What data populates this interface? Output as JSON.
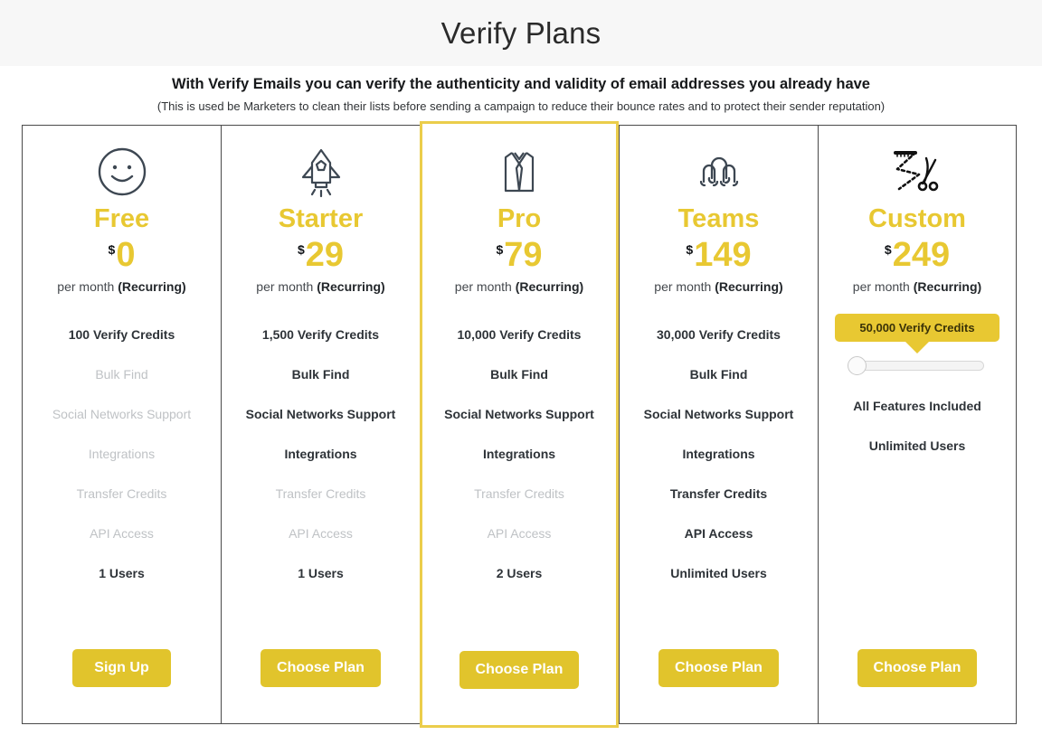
{
  "header": {
    "title": "Verify Plans",
    "subheading": "With Verify Emails you can verify the authenticity and validity of email addresses you already have",
    "subnote": "(This is used be Marketers to clean their lists before sending a campaign to reduce their bounce rates and to protect their sender reputation)"
  },
  "colors": {
    "accent_yellow": "#e8c832",
    "button_yellow": "#e1c42c",
    "featured_border": "#ebcd4b",
    "card_border": "#4a4a4a",
    "text_dark": "#2e3338",
    "text_disabled": "#bfc2c5",
    "header_band": "#f7f7f7"
  },
  "currency_symbol": "$",
  "period_label_prefix": "per month ",
  "period_label_bold": "(Recurring)",
  "plans": [
    {
      "id": "free",
      "name": "Free",
      "icon": "smiley-face-icon",
      "price": "0",
      "period_prefix": "per month ",
      "period_bold": "(Recurring)",
      "featured": false,
      "features": [
        {
          "label": "100 Verify Credits",
          "enabled": true
        },
        {
          "label": "Bulk Find",
          "enabled": false
        },
        {
          "label": "Social Networks Support",
          "enabled": false
        },
        {
          "label": "Integrations",
          "enabled": false
        },
        {
          "label": "Transfer Credits",
          "enabled": false
        },
        {
          "label": "API Access",
          "enabled": false
        },
        {
          "label": "1 Users",
          "enabled": true
        }
      ],
      "cta": "Sign Up"
    },
    {
      "id": "starter",
      "name": "Starter",
      "icon": "rocket-icon",
      "price": "29",
      "period_prefix": "per month ",
      "period_bold": "(Recurring)",
      "featured": false,
      "features": [
        {
          "label": "1,500 Verify Credits",
          "enabled": true
        },
        {
          "label": "Bulk Find",
          "enabled": true
        },
        {
          "label": "Social Networks Support",
          "enabled": true
        },
        {
          "label": "Integrations",
          "enabled": true
        },
        {
          "label": "Transfer Credits",
          "enabled": false
        },
        {
          "label": "API Access",
          "enabled": false
        },
        {
          "label": "1 Users",
          "enabled": true
        }
      ],
      "cta": "Choose Plan"
    },
    {
      "id": "pro",
      "name": "Pro",
      "icon": "shirt-tie-icon",
      "price": "79",
      "period_prefix": "per month ",
      "period_bold": "(Recurring)",
      "featured": true,
      "features": [
        {
          "label": "10,000 Verify Credits",
          "enabled": true
        },
        {
          "label": "Bulk Find",
          "enabled": true
        },
        {
          "label": "Social Networks Support",
          "enabled": true
        },
        {
          "label": "Integrations",
          "enabled": true
        },
        {
          "label": "Transfer Credits",
          "enabled": false
        },
        {
          "label": "API Access",
          "enabled": false
        },
        {
          "label": "2 Users",
          "enabled": true
        }
      ],
      "cta": "Choose Plan"
    },
    {
      "id": "teams",
      "name": "Teams",
      "icon": "three-people-icon",
      "price": "149",
      "period_prefix": "per month ",
      "period_bold": "(Recurring)",
      "featured": false,
      "features": [
        {
          "label": "30,000 Verify Credits",
          "enabled": true
        },
        {
          "label": "Bulk Find",
          "enabled": true
        },
        {
          "label": "Social Networks Support",
          "enabled": true
        },
        {
          "label": "Integrations",
          "enabled": true
        },
        {
          "label": "Transfer Credits",
          "enabled": true
        },
        {
          "label": "API Access",
          "enabled": true
        },
        {
          "label": "Unlimited Users",
          "enabled": true
        }
      ],
      "cta": "Choose Plan"
    },
    {
      "id": "custom",
      "name": "Custom",
      "icon": "tape-measure-scissors-icon",
      "price": "249",
      "period_prefix": "per month ",
      "period_bold": "(Recurring)",
      "featured": false,
      "slider": {
        "bubble_label": "50,000 Verify Credits",
        "value_percent": 0
      },
      "features": [
        {
          "label": "All Features Included",
          "enabled": true
        },
        {
          "label": "Unlimited Users",
          "enabled": true
        }
      ],
      "cta": "Choose Plan"
    }
  ]
}
